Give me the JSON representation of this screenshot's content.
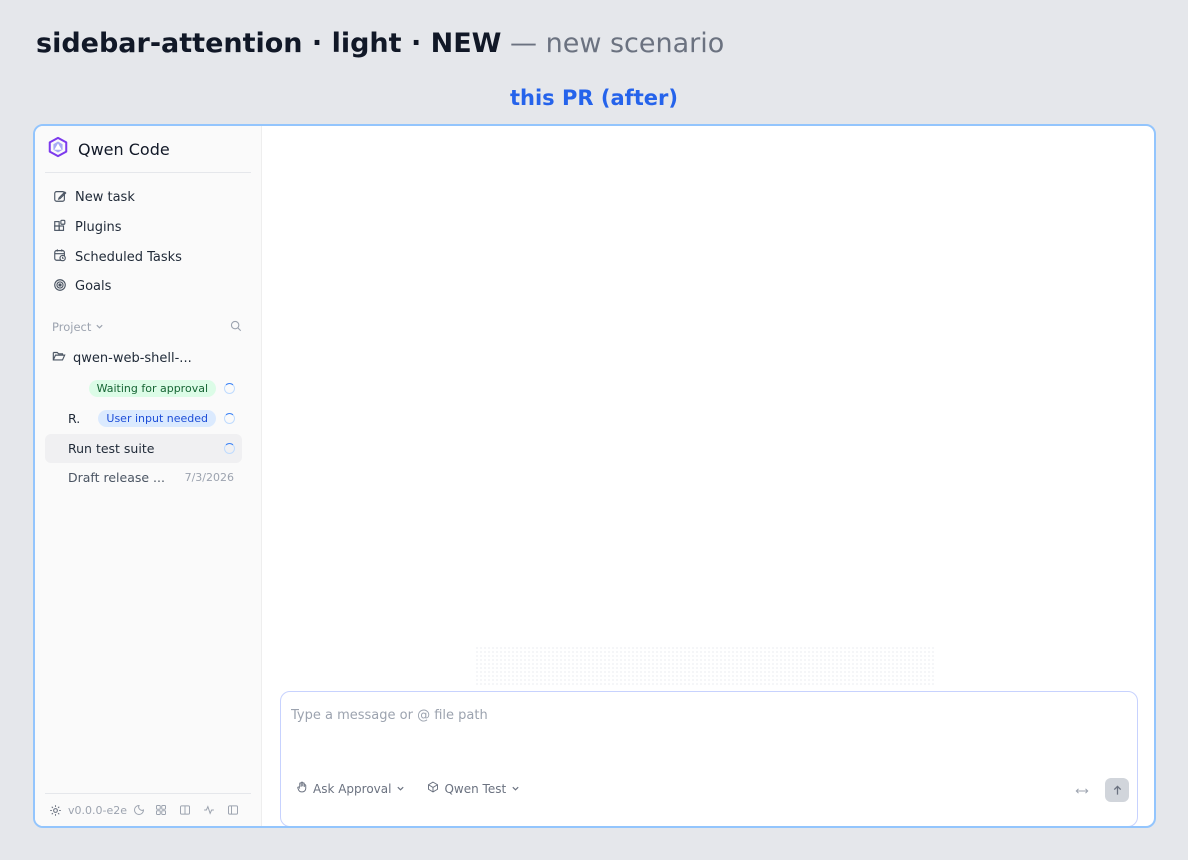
{
  "page": {
    "heading_bold": "sidebar-attention · light · NEW",
    "heading_rest": " — new scenario",
    "subheading": "this PR (after)"
  },
  "sidebar": {
    "brand": "Qwen Code",
    "nav": [
      {
        "label": "New task",
        "icon": "edit-icon"
      },
      {
        "label": "Plugins",
        "icon": "plugins-icon"
      },
      {
        "label": "Scheduled Tasks",
        "icon": "calendar-clock-icon"
      },
      {
        "label": "Goals",
        "icon": "target-icon"
      }
    ],
    "project_label": "Project",
    "folder_name": "qwen-web-shell-...",
    "sessions": [
      {
        "title": "",
        "badge": "Waiting for approval",
        "badge_color": "#dcfce7",
        "status": "running"
      },
      {
        "title": "R.",
        "badge": "User input needed",
        "badge_color": "#dbeafe",
        "status": "running"
      },
      {
        "title": "Run test suite",
        "badge": "",
        "status": "running",
        "active": true
      },
      {
        "title": "Draft release ...",
        "date": "7/3/2026"
      }
    ],
    "version": "v0.0.0-e2e"
  },
  "composer": {
    "placeholder": "Type a message or @ file path",
    "approval_mode": "Ask Approval",
    "model": "Qwen Test"
  },
  "colors": {
    "accent": "#2563eb",
    "frame_border": "#93c5fd",
    "spinner": "#3b82f6"
  }
}
